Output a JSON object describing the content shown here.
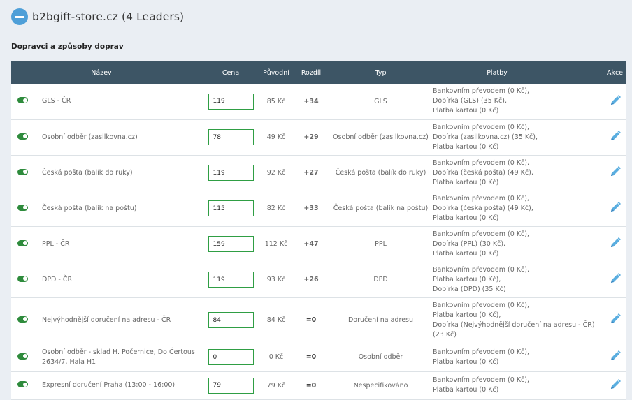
{
  "header": {
    "title": "b2bgift-store.cz (4 Leaders)"
  },
  "section": {
    "title": "Dopravci a způsoby doprav"
  },
  "table": {
    "columns": {
      "name": "Název",
      "price": "Cena",
      "original": "Původní",
      "diff": "Rozdíl",
      "type": "Typ",
      "payments": "Platby",
      "actions": "Akce"
    },
    "rows": [
      {
        "enabled": true,
        "name": "GLS - ČR",
        "price": "119",
        "original": "85 Kč",
        "diff": "+34",
        "type": "GLS",
        "payments": [
          "Bankovním převodem (0 Kč),",
          "Dobírka (GLS) (35 Kč),",
          "Platba kartou (0 Kč)"
        ]
      },
      {
        "enabled": true,
        "name": "Osobní odběr (zasilkovna.cz)",
        "price": "78",
        "original": "49 Kč",
        "diff": "+29",
        "type": "Osobní odběr (zasilkovna.cz)",
        "payments": [
          "Bankovním převodem (0 Kč),",
          "Dobírka (zasilkovna.cz) (35 Kč),",
          "Platba kartou (0 Kč)"
        ]
      },
      {
        "enabled": true,
        "name": "Česká pošta (balík do ruky)",
        "price": "119",
        "original": "92 Kč",
        "diff": "+27",
        "type": "Česká pošta (balík do ruky)",
        "payments": [
          "Bankovním převodem (0 Kč),",
          "Dobírka (česká pošta) (49 Kč),",
          "Platba kartou (0 Kč)"
        ]
      },
      {
        "enabled": true,
        "name": "Česká pošta (balík na poštu)",
        "price": "115",
        "original": "82 Kč",
        "diff": "+33",
        "type": "Česká pošta (balík na poštu)",
        "payments": [
          "Bankovním převodem (0 Kč),",
          "Dobírka (česká pošta) (49 Kč),",
          "Platba kartou (0 Kč)"
        ]
      },
      {
        "enabled": true,
        "name": "PPL - ČR",
        "price": "159",
        "original": "112 Kč",
        "diff": "+47",
        "type": "PPL",
        "payments": [
          "Bankovním převodem (0 Kč),",
          "Dobírka (PPL) (30 Kč),",
          "Platba kartou (0 Kč)"
        ]
      },
      {
        "enabled": true,
        "name": "DPD - ČR",
        "price": "119",
        "original": "93 Kč",
        "diff": "+26",
        "type": "DPD",
        "payments": [
          "Bankovním převodem (0 Kč),",
          "Platba kartou (0 Kč),",
          "Dobírka (DPD) (35 Kč)"
        ]
      },
      {
        "enabled": true,
        "name": "Nejvýhodnější doručení na adresu - ČR",
        "price": "84",
        "original": "84 Kč",
        "diff": "=0",
        "type": "Doručení na adresu",
        "payments": [
          "Bankovním převodem (0 Kč),",
          "Platba kartou (0 Kč),",
          "Dobírka (Nejvýhodnější doručení na adresu - ČR) (23 Kč)"
        ]
      },
      {
        "enabled": true,
        "name": "Osobní odběr - sklad H. Počernice, Do Čertous 2634/7, Hala H1",
        "price": "0",
        "original": "0 Kč",
        "diff": "=0",
        "type": "Osobní odběr",
        "payments": [
          "Bankovním převodem (0 Kč),",
          "Platba kartou (0 Kč)"
        ]
      },
      {
        "enabled": true,
        "name": "Expresní doručení Praha (13:00 - 16:00)",
        "price": "79",
        "original": "79 Kč",
        "diff": "=0",
        "type": "Nespecifikováno",
        "payments": [
          "Bankovním převodem (0 Kč),",
          "Platba kartou (0 Kč)"
        ]
      }
    ]
  },
  "colors": {
    "header_bg": "#3d5565",
    "toggle_on": "#2e8b3c",
    "payment_text": "#5bb85d",
    "diff_positive": "#47b04a",
    "edit_icon": "#5aaee0"
  },
  "icons": {
    "collapse": "minus-circle-icon",
    "edit": "pencil-icon"
  }
}
